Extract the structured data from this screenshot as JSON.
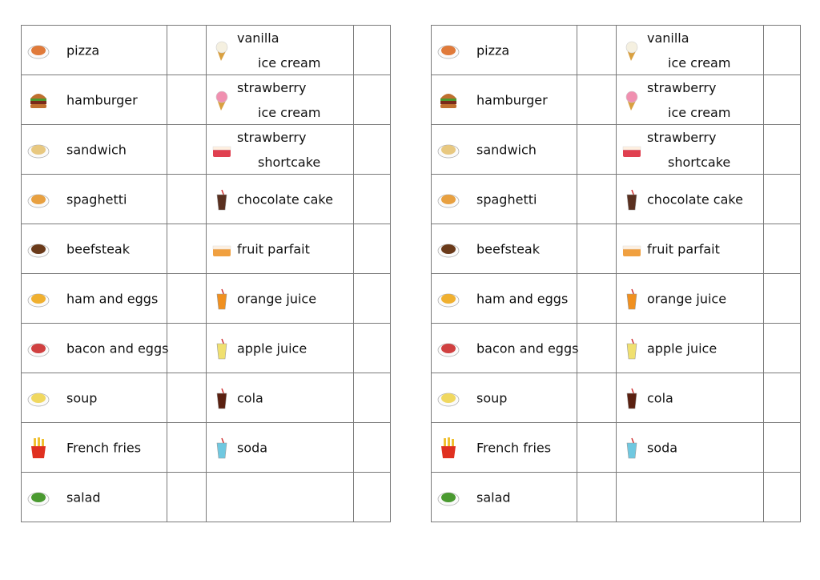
{
  "sheets": [
    {
      "foods": [
        {
          "label": "pizza",
          "icon": "pizza-icon",
          "color": "#e07a3a"
        },
        {
          "label": "hamburger",
          "icon": "hamburger-icon",
          "color": "#8a4a1e"
        },
        {
          "label": "sandwich",
          "icon": "sandwich-icon",
          "color": "#e8c880"
        },
        {
          "label": "spaghetti",
          "icon": "spaghetti-icon",
          "color": "#e8a040"
        },
        {
          "label": "beefsteak",
          "icon": "beefsteak-icon",
          "color": "#6a3a1a"
        },
        {
          "label": "ham and eggs",
          "icon": "ham-and-eggs-icon",
          "color": "#f0b030"
        },
        {
          "label": "bacon and eggs",
          "icon": "bacon-and-eggs-icon",
          "color": "#d04040"
        },
        {
          "label": "soup",
          "icon": "soup-icon",
          "color": "#f0d860"
        },
        {
          "label": "French fries",
          "icon": "french-fries-icon",
          "color": "#e03020"
        },
        {
          "label": "salad",
          "icon": "salad-icon",
          "color": "#4a9a30"
        }
      ],
      "drinks": [
        {
          "line1": "vanilla",
          "line2": "ice cream",
          "icon": "vanilla-ice-cream-icon",
          "color": "#f5f0e0"
        },
        {
          "line1": "strawberry",
          "line2": "ice cream",
          "icon": "strawberry-ice-cream-icon",
          "color": "#f090b0"
        },
        {
          "line1": "strawberry",
          "line2": "shortcake",
          "icon": "strawberry-shortcake-icon",
          "color": "#e04050"
        },
        {
          "label": "chocolate cake",
          "icon": "chocolate-cake-icon",
          "color": "#5a3020"
        },
        {
          "label": "fruit parfait",
          "icon": "fruit-parfait-icon",
          "color": "#f0a040"
        },
        {
          "label": "orange juice",
          "icon": "orange-juice-icon",
          "color": "#f09020"
        },
        {
          "label": "apple juice",
          "icon": "apple-juice-icon",
          "color": "#f0e070"
        },
        {
          "label": "cola",
          "icon": "cola-icon",
          "color": "#5a2010"
        },
        {
          "label": "soda",
          "icon": "soda-icon",
          "color": "#70c8e0"
        },
        {}
      ]
    },
    {
      "foods": [
        {
          "label": "pizza",
          "icon": "pizza-icon",
          "color": "#e07a3a"
        },
        {
          "label": "hamburger",
          "icon": "hamburger-icon",
          "color": "#8a4a1e"
        },
        {
          "label": "sandwich",
          "icon": "sandwich-icon",
          "color": "#e8c880"
        },
        {
          "label": "spaghetti",
          "icon": "spaghetti-icon",
          "color": "#e8a040"
        },
        {
          "label": "beefsteak",
          "icon": "beefsteak-icon",
          "color": "#6a3a1a"
        },
        {
          "label": "ham and eggs",
          "icon": "ham-and-eggs-icon",
          "color": "#f0b030"
        },
        {
          "label": "bacon and eggs",
          "icon": "bacon-and-eggs-icon",
          "color": "#d04040"
        },
        {
          "label": "soup",
          "icon": "soup-icon",
          "color": "#f0d860"
        },
        {
          "label": "French fries",
          "icon": "french-fries-icon",
          "color": "#e03020"
        },
        {
          "label": "salad",
          "icon": "salad-icon",
          "color": "#4a9a30"
        }
      ],
      "drinks": [
        {
          "line1": "vanilla",
          "line2": "ice cream",
          "icon": "vanilla-ice-cream-icon",
          "color": "#f5f0e0"
        },
        {
          "line1": "strawberry",
          "line2": "ice cream",
          "icon": "strawberry-ice-cream-icon",
          "color": "#f090b0"
        },
        {
          "line1": "strawberry",
          "line2": "shortcake",
          "icon": "strawberry-shortcake-icon",
          "color": "#e04050"
        },
        {
          "label": "chocolate cake",
          "icon": "chocolate-cake-icon",
          "color": "#5a3020"
        },
        {
          "label": "fruit parfait",
          "icon": "fruit-parfait-icon",
          "color": "#f0a040"
        },
        {
          "label": "orange juice",
          "icon": "orange-juice-icon",
          "color": "#f09020"
        },
        {
          "label": "apple juice",
          "icon": "apple-juice-icon",
          "color": "#f0e070"
        },
        {
          "label": "cola",
          "icon": "cola-icon",
          "color": "#5a2010"
        },
        {
          "label": "soda",
          "icon": "soda-icon",
          "color": "#70c8e0"
        },
        {}
      ]
    }
  ]
}
